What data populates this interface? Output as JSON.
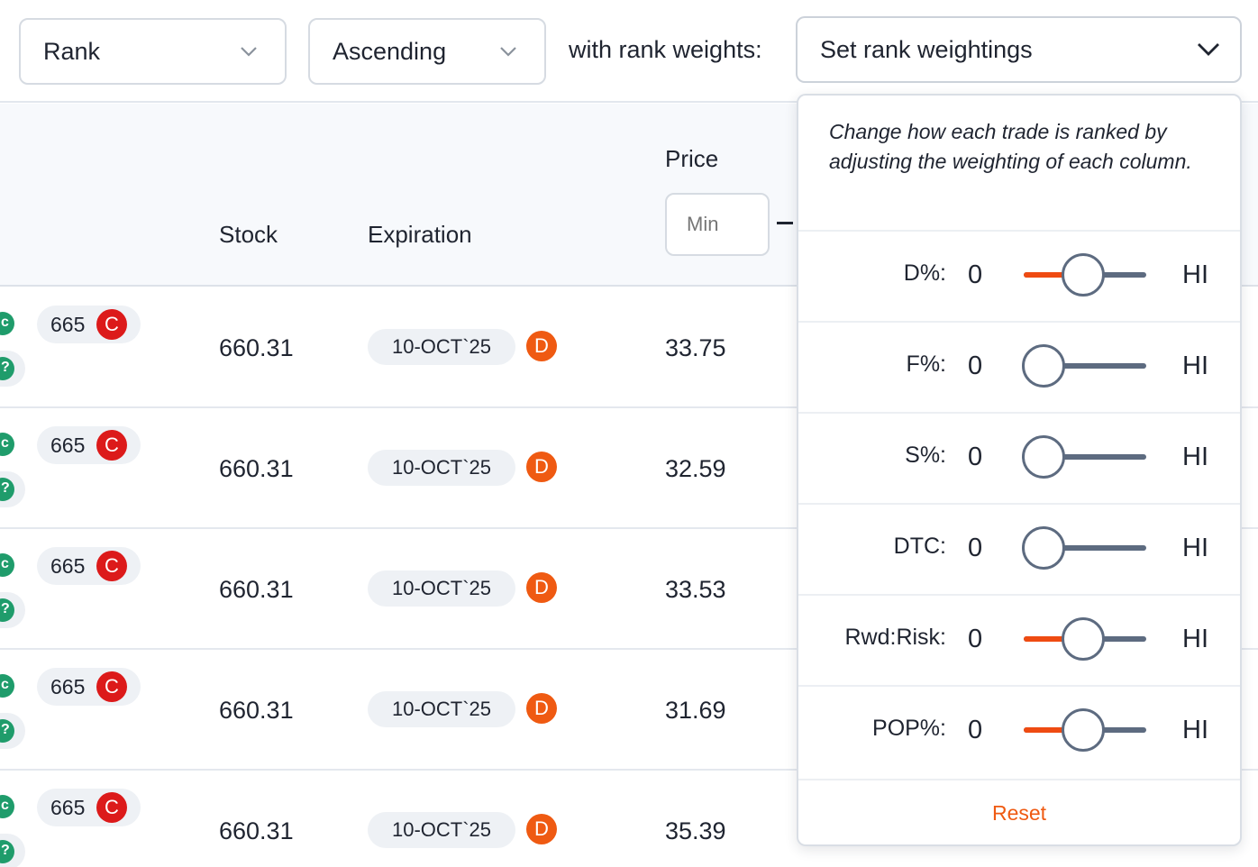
{
  "toolbar": {
    "sort_field": "Rank",
    "sort_order": "Ascending",
    "with_label": "with rank weights:",
    "weights_dropdown": "Set rank weightings"
  },
  "table": {
    "headers": {
      "stock": "Stock",
      "expiration": "Expiration",
      "price": "Price"
    },
    "price_min_placeholder": "Min",
    "rows": [
      {
        "strike": "665",
        "call_badge": "C",
        "stock": "660.31",
        "expiration": "10-OCT`25",
        "exp_badge": "D",
        "price": "33.75"
      },
      {
        "strike": "665",
        "call_badge": "C",
        "stock": "660.31",
        "expiration": "10-OCT`25",
        "exp_badge": "D",
        "price": "32.59"
      },
      {
        "strike": "665",
        "call_badge": "C",
        "stock": "660.31",
        "expiration": "10-OCT`25",
        "exp_badge": "D",
        "price": "33.53"
      },
      {
        "strike": "665",
        "call_badge": "C",
        "stock": "660.31",
        "expiration": "10-OCT`25",
        "exp_badge": "D",
        "price": "31.69"
      },
      {
        "strike": "665",
        "call_badge": "C",
        "stock": "660.31",
        "expiration": "10-OCT`25",
        "exp_badge": "D",
        "price": "35.39"
      }
    ]
  },
  "weights_panel": {
    "description": "Change how each trade is ranked by adjusting the weighting of each column.",
    "low_label": "0",
    "high_label": "HI",
    "weights": [
      {
        "label": "D%:",
        "level": 0.5
      },
      {
        "label": "F%:",
        "level": 0
      },
      {
        "label": "S%:",
        "level": 0
      },
      {
        "label": "DTC:",
        "level": 0
      },
      {
        "label": "Rwd:Risk:",
        "level": 0.5
      },
      {
        "label": "POP%:",
        "level": 0.5
      }
    ],
    "reset_label": "Reset"
  },
  "colors": {
    "accent": "#ef4b12",
    "call_badge": "#dc1a1a",
    "exp_badge": "#ef5a12",
    "slider_track": "#5d6b80"
  }
}
